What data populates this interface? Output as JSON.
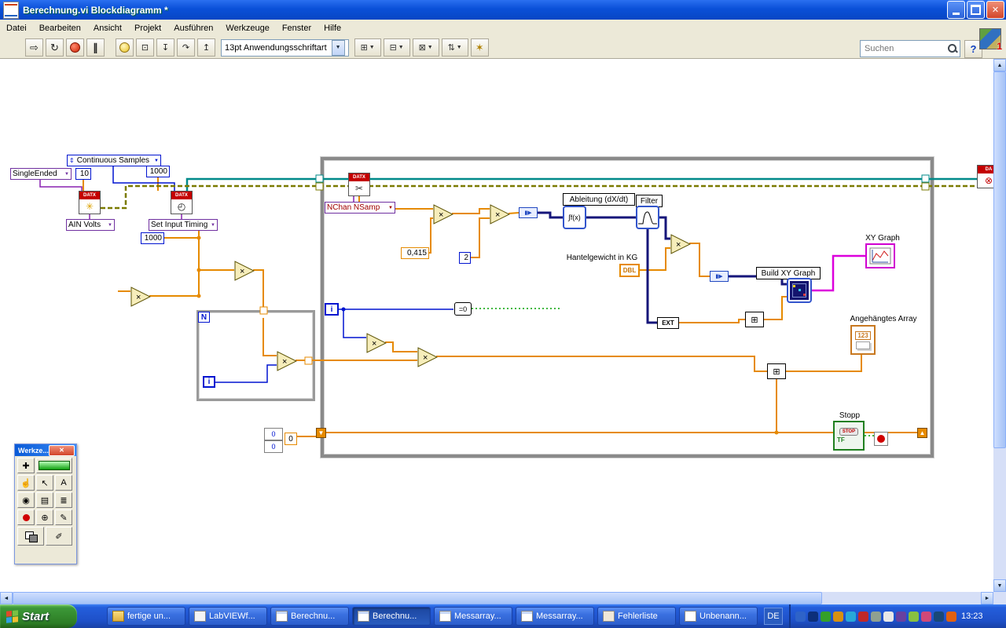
{
  "titlebar": {
    "title": "Berechnung.vi Blockdiagramm *"
  },
  "menubar": {
    "items": [
      "Datei",
      "Bearbeiten",
      "Ansicht",
      "Projekt",
      "Ausführen",
      "Werkzeuge",
      "Fenster",
      "Hilfe"
    ]
  },
  "toolbar": {
    "font_selector": "13pt Anwendungsschriftart",
    "search_placeholder": "Suchen",
    "badge": "1"
  },
  "glyphs": {
    "caret": "▼",
    "enum_arrows": "⇕",
    "run": "⇨",
    "run_continuous": "↻",
    "pause": "∥",
    "step_into": "↧",
    "step_over": "↷",
    "step_out": "↥",
    "retain": "⊡",
    "align": "⊞",
    "distribute": "⊟",
    "resize": "⊠",
    "reorder": "⇅",
    "cleanup": "✶",
    "help": "?",
    "close": "✕",
    "scroll_left": "◄",
    "scroll_right": "►",
    "scroll_up": "▲",
    "scroll_down": "▼",
    "shift_down": "▼",
    "shift_up": "▲",
    "multiply": "×",
    "coerce": "▮▶",
    "array_fn": "⊞",
    "tool_auto": "✚",
    "tool_operate": "☝",
    "tool_position": "↖",
    "tool_text": "A",
    "tool_wire": "◉",
    "tool_menu": "▤",
    "tool_scroll": "≣",
    "tool_probe": "⊕",
    "tool_copy_color": "✎",
    "tool_paint": "✐",
    "clock_face": "◴",
    "starburst": "✳",
    "scissors": "✂",
    "cross_out": "⊗"
  },
  "diagram": {
    "dropdowns": {
      "continuous_samples": "Continuous Samples",
      "single_ended": "SingleEnded",
      "ain_volts": "AIN Volts",
      "set_input_timing": "Set Input Timing",
      "nchan_nsamp": "NChan NSamp"
    },
    "constants": {
      "ten": "10",
      "samples_top": "1000",
      "samples_left": "1000",
      "factor": "0,415",
      "two": "2",
      "zero": "0"
    },
    "labels": {
      "ableitung": "Ableitung (dX/dt)",
      "filter": "Filter",
      "hantelgewicht": "Hantelgewicht in KG",
      "build_xy": "Build XY Graph",
      "xy_graph": "XY Graph",
      "angehaengtes_array": "Angehängtes Array",
      "stopp": "Stopp"
    },
    "nodes": {
      "datx": "DATX",
      "da_partial": "DA",
      "integral": "∫f(x)",
      "dbl": "DBL",
      "ext": "EXT",
      "eq_zero": "=0",
      "n": "N",
      "i": "i",
      "stop": "STOP",
      "tf": "TF",
      "array_123": "123"
    }
  },
  "tools_palette": {
    "title": "Werkze..."
  },
  "taskbar": {
    "start": "Start",
    "buttons": [
      {
        "label": "fertige un..."
      },
      {
        "label": "LabVIEWf..."
      },
      {
        "label": "Berechnu..."
      },
      {
        "label": "Berechnu..."
      },
      {
        "label": "Messarray..."
      },
      {
        "label": "Messarray..."
      },
      {
        "label": "Fehlerliste"
      },
      {
        "label": "Unbenann..."
      }
    ],
    "language": "DE",
    "clock": "13:23"
  },
  "colors": {
    "wire_orange": "#e68a00",
    "wire_blue": "#0014d0",
    "wire_navy": "#16167a",
    "wire_teal": "#008a8a",
    "wire_magenta": "#dc00dc",
    "wire_green": "#00a000",
    "wire_error": "#7a7a00",
    "loop_border": "#8a8a8a",
    "xp_blue": "#0a50d8",
    "taskbar_blue": "#245edc",
    "datx_red": "#c40000"
  }
}
